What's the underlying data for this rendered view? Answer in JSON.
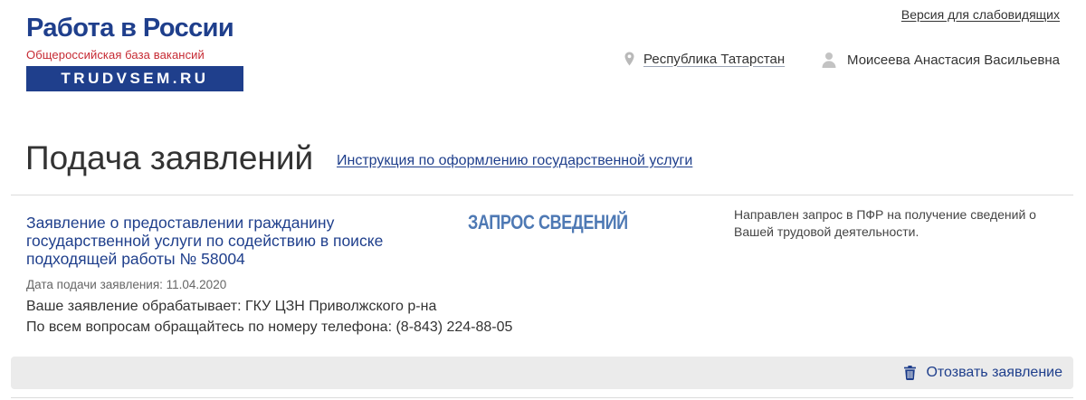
{
  "header": {
    "logo": {
      "title": "Работа в России",
      "subtitle": "Общероссийская база вакансий",
      "domain": "TRUDVSEM.RU"
    },
    "accessibility_link": "Версия для слабовидящих",
    "region": {
      "icon": "location-pin-icon",
      "label": "Республика Татарстан"
    },
    "user": {
      "icon": "user-icon",
      "name": "Моисеева Анастасия Васильевна"
    }
  },
  "page": {
    "title": "Подача заявлений",
    "instructions_link": "Инструкция по оформлению государственной услуги"
  },
  "application": {
    "title": "Заявление о предоставлении гражданину государственной услуги по содействию в поиске подходящей работы № 58004",
    "status": "ЗАПРОС СВЕДЕНИЙ",
    "status_description": "Направлен запрос в ПФР на получение сведений о Вашей трудовой деятельности.",
    "submit_date": "Дата подачи заявления: 11.04.2020",
    "processed_by": "Ваше заявление обрабатывает: ГКУ ЦЗН Приволжского р-на",
    "contact": "По всем вопросам обращайтесь по номеру телефона: (8-843) 224-88-05",
    "actions": {
      "withdraw_icon": "trash-icon",
      "withdraw_label": "Отозвать заявление"
    }
  },
  "colors": {
    "brand_blue": "#1f3f8c",
    "brand_red": "#c62a33",
    "status_blue": "#4e79b4",
    "action_bar_bg": "#ebebeb"
  }
}
